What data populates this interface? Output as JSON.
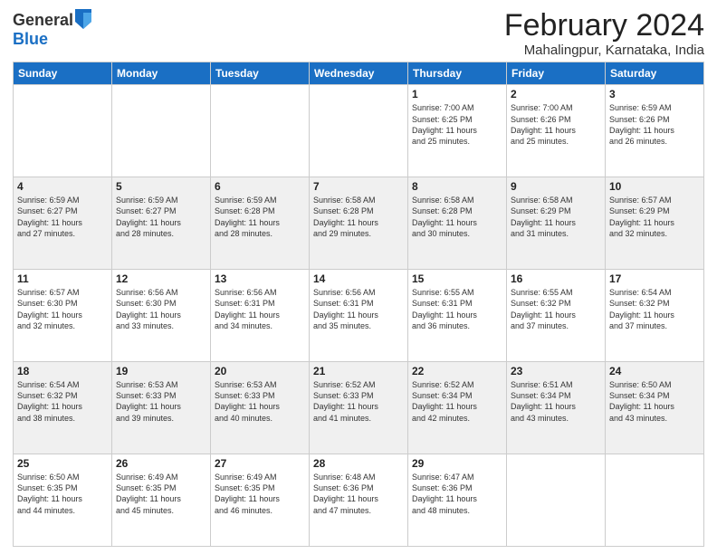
{
  "logo": {
    "general": "General",
    "blue": "Blue"
  },
  "title": "February 2024",
  "location": "Mahalingpur, Karnataka, India",
  "days_of_week": [
    "Sunday",
    "Monday",
    "Tuesday",
    "Wednesday",
    "Thursday",
    "Friday",
    "Saturday"
  ],
  "weeks": [
    [
      {
        "day": "",
        "info": ""
      },
      {
        "day": "",
        "info": ""
      },
      {
        "day": "",
        "info": ""
      },
      {
        "day": "",
        "info": ""
      },
      {
        "day": "1",
        "info": "Sunrise: 7:00 AM\nSunset: 6:25 PM\nDaylight: 11 hours\nand 25 minutes."
      },
      {
        "day": "2",
        "info": "Sunrise: 7:00 AM\nSunset: 6:26 PM\nDaylight: 11 hours\nand 25 minutes."
      },
      {
        "day": "3",
        "info": "Sunrise: 6:59 AM\nSunset: 6:26 PM\nDaylight: 11 hours\nand 26 minutes."
      }
    ],
    [
      {
        "day": "4",
        "info": "Sunrise: 6:59 AM\nSunset: 6:27 PM\nDaylight: 11 hours\nand 27 minutes."
      },
      {
        "day": "5",
        "info": "Sunrise: 6:59 AM\nSunset: 6:27 PM\nDaylight: 11 hours\nand 28 minutes."
      },
      {
        "day": "6",
        "info": "Sunrise: 6:59 AM\nSunset: 6:28 PM\nDaylight: 11 hours\nand 28 minutes."
      },
      {
        "day": "7",
        "info": "Sunrise: 6:58 AM\nSunset: 6:28 PM\nDaylight: 11 hours\nand 29 minutes."
      },
      {
        "day": "8",
        "info": "Sunrise: 6:58 AM\nSunset: 6:28 PM\nDaylight: 11 hours\nand 30 minutes."
      },
      {
        "day": "9",
        "info": "Sunrise: 6:58 AM\nSunset: 6:29 PM\nDaylight: 11 hours\nand 31 minutes."
      },
      {
        "day": "10",
        "info": "Sunrise: 6:57 AM\nSunset: 6:29 PM\nDaylight: 11 hours\nand 32 minutes."
      }
    ],
    [
      {
        "day": "11",
        "info": "Sunrise: 6:57 AM\nSunset: 6:30 PM\nDaylight: 11 hours\nand 32 minutes."
      },
      {
        "day": "12",
        "info": "Sunrise: 6:56 AM\nSunset: 6:30 PM\nDaylight: 11 hours\nand 33 minutes."
      },
      {
        "day": "13",
        "info": "Sunrise: 6:56 AM\nSunset: 6:31 PM\nDaylight: 11 hours\nand 34 minutes."
      },
      {
        "day": "14",
        "info": "Sunrise: 6:56 AM\nSunset: 6:31 PM\nDaylight: 11 hours\nand 35 minutes."
      },
      {
        "day": "15",
        "info": "Sunrise: 6:55 AM\nSunset: 6:31 PM\nDaylight: 11 hours\nand 36 minutes."
      },
      {
        "day": "16",
        "info": "Sunrise: 6:55 AM\nSunset: 6:32 PM\nDaylight: 11 hours\nand 37 minutes."
      },
      {
        "day": "17",
        "info": "Sunrise: 6:54 AM\nSunset: 6:32 PM\nDaylight: 11 hours\nand 37 minutes."
      }
    ],
    [
      {
        "day": "18",
        "info": "Sunrise: 6:54 AM\nSunset: 6:32 PM\nDaylight: 11 hours\nand 38 minutes."
      },
      {
        "day": "19",
        "info": "Sunrise: 6:53 AM\nSunset: 6:33 PM\nDaylight: 11 hours\nand 39 minutes."
      },
      {
        "day": "20",
        "info": "Sunrise: 6:53 AM\nSunset: 6:33 PM\nDaylight: 11 hours\nand 40 minutes."
      },
      {
        "day": "21",
        "info": "Sunrise: 6:52 AM\nSunset: 6:33 PM\nDaylight: 11 hours\nand 41 minutes."
      },
      {
        "day": "22",
        "info": "Sunrise: 6:52 AM\nSunset: 6:34 PM\nDaylight: 11 hours\nand 42 minutes."
      },
      {
        "day": "23",
        "info": "Sunrise: 6:51 AM\nSunset: 6:34 PM\nDaylight: 11 hours\nand 43 minutes."
      },
      {
        "day": "24",
        "info": "Sunrise: 6:50 AM\nSunset: 6:34 PM\nDaylight: 11 hours\nand 43 minutes."
      }
    ],
    [
      {
        "day": "25",
        "info": "Sunrise: 6:50 AM\nSunset: 6:35 PM\nDaylight: 11 hours\nand 44 minutes."
      },
      {
        "day": "26",
        "info": "Sunrise: 6:49 AM\nSunset: 6:35 PM\nDaylight: 11 hours\nand 45 minutes."
      },
      {
        "day": "27",
        "info": "Sunrise: 6:49 AM\nSunset: 6:35 PM\nDaylight: 11 hours\nand 46 minutes."
      },
      {
        "day": "28",
        "info": "Sunrise: 6:48 AM\nSunset: 6:36 PM\nDaylight: 11 hours\nand 47 minutes."
      },
      {
        "day": "29",
        "info": "Sunrise: 6:47 AM\nSunset: 6:36 PM\nDaylight: 11 hours\nand 48 minutes."
      },
      {
        "day": "",
        "info": ""
      },
      {
        "day": "",
        "info": ""
      }
    ]
  ]
}
